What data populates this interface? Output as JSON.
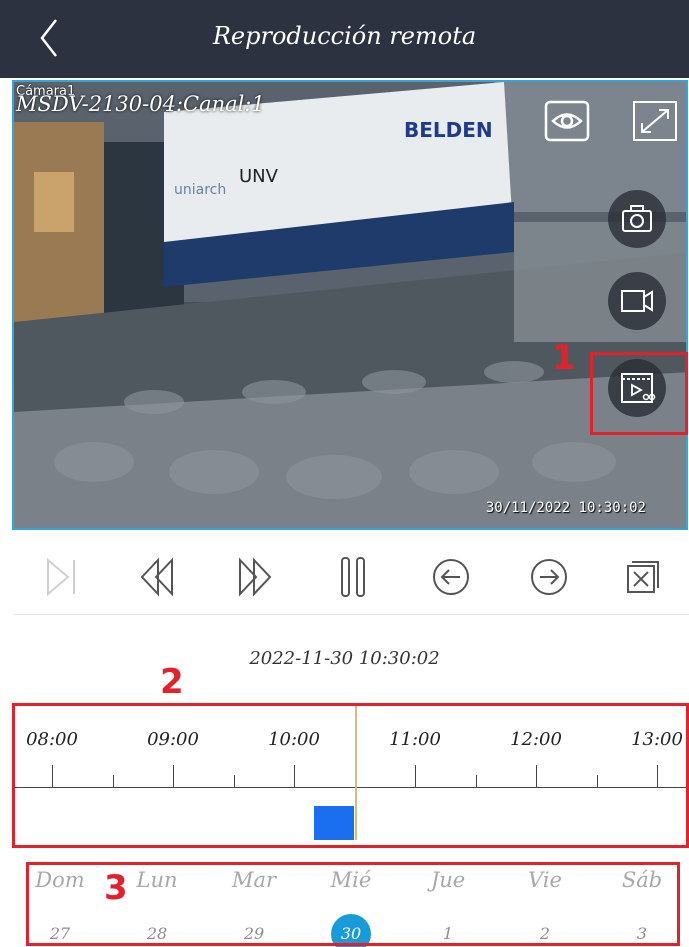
{
  "header": {
    "title": "Reproducción remota",
    "back_icon": "chevron-left-icon"
  },
  "video": {
    "camera_label": "Cámara1",
    "channel_label": "MSDV-2130-04:Canal:1",
    "osd_timestamp": "30/11/2022 10:30:02",
    "buttons": [
      "eye-icon",
      "fullscreen-icon",
      "camera-icon",
      "video-record-icon",
      "video-clip-icon"
    ],
    "annotation": "1"
  },
  "controls": [
    "skip-end-icon",
    "rewind-icon",
    "fast-forward-icon",
    "pause-icon",
    "arrow-left-circle-icon",
    "arrow-right-circle-icon",
    "close-multi-icon"
  ],
  "playback_time": "2022-11-30 10:30:02",
  "timeline": {
    "annotation": "2",
    "hours": [
      "08:00",
      "09:00",
      "10:00",
      "11:00",
      "12:00",
      "13:00"
    ],
    "cursor_time": "10:30",
    "record_segment": {
      "start": "10:10",
      "end": "10:30"
    }
  },
  "calendar": {
    "annotation": "3",
    "days": [
      {
        "name": "Dom",
        "num": "27"
      },
      {
        "name": "Lun",
        "num": "28"
      },
      {
        "name": "Mar",
        "num": "29"
      },
      {
        "name": "Mié",
        "num": "30"
      },
      {
        "name": "Jue",
        "num": "1"
      },
      {
        "name": "Vie",
        "num": "2"
      },
      {
        "name": "Sáb",
        "num": "3"
      }
    ],
    "selected_index": 3
  },
  "colors": {
    "header_bg": "#2d3240",
    "accent": "#1a9bd9",
    "record": "#1a6ef0",
    "annotation": "#e2222b"
  }
}
